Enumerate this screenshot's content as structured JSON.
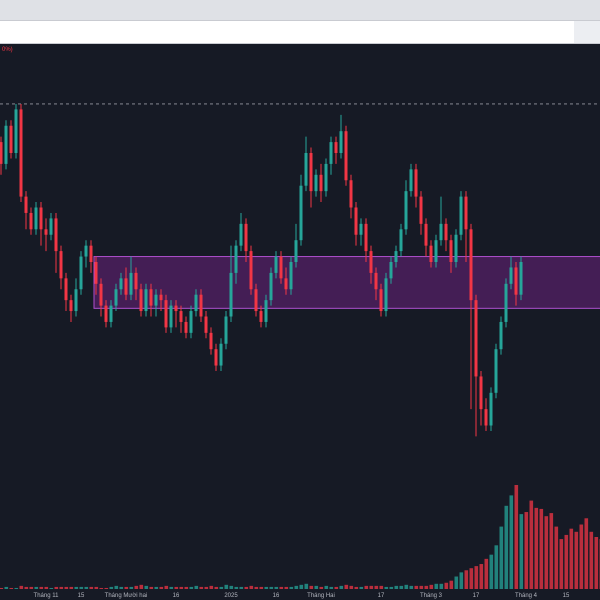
{
  "legend_fragment": "0%)",
  "colors": {
    "up": "#26a69a",
    "down": "#f23645",
    "background": "#161a25",
    "zone_fill": "rgba(156, 39, 176, 0.35)",
    "zone_border": "#b04fcf"
  },
  "chart_data": {
    "type": "candlestick",
    "title": "",
    "x_tick_labels": [
      "Tháng 11",
      "15",
      "Tháng Mười hai",
      "16",
      "2025",
      "16",
      "Tháng Hai",
      "17",
      "Tháng 3",
      "17",
      "Tháng 4",
      "15"
    ],
    "y_range": [
      0,
      100
    ],
    "reference_line_level": 89.0,
    "zone": {
      "low": 51.5,
      "high": 61.0
    },
    "grid": false,
    "candles": [
      {
        "o": 73,
        "c": 75,
        "h": 76,
        "l": 72
      },
      {
        "o": 75,
        "c": 82,
        "h": 84,
        "l": 74
      },
      {
        "o": 82,
        "c": 78,
        "h": 83,
        "l": 76
      },
      {
        "o": 78,
        "c": 85,
        "h": 86,
        "l": 77
      },
      {
        "o": 85,
        "c": 80,
        "h": 86,
        "l": 79
      },
      {
        "o": 80,
        "c": 88,
        "h": 89,
        "l": 79
      },
      {
        "o": 88,
        "c": 72,
        "h": 89,
        "l": 71
      },
      {
        "o": 72,
        "c": 69,
        "h": 73,
        "l": 66
      },
      {
        "o": 69,
        "c": 66,
        "h": 70,
        "l": 65
      },
      {
        "o": 66,
        "c": 70,
        "h": 71,
        "l": 65
      },
      {
        "o": 70,
        "c": 66,
        "h": 71,
        "l": 63
      },
      {
        "o": 66,
        "c": 65,
        "h": 68,
        "l": 62
      },
      {
        "o": 65,
        "c": 68,
        "h": 69,
        "l": 64
      },
      {
        "o": 68,
        "c": 62,
        "h": 69,
        "l": 58
      },
      {
        "o": 62,
        "c": 57,
        "h": 63,
        "l": 55
      },
      {
        "o": 57,
        "c": 53,
        "h": 58,
        "l": 51
      },
      {
        "o": 53,
        "c": 51,
        "h": 54,
        "l": 49
      },
      {
        "o": 51,
        "c": 55,
        "h": 57,
        "l": 50
      },
      {
        "o": 55,
        "c": 61,
        "h": 62,
        "l": 54
      },
      {
        "o": 61,
        "c": 63,
        "h": 64,
        "l": 59
      },
      {
        "o": 63,
        "c": 60,
        "h": 64,
        "l": 58
      },
      {
        "o": 60,
        "c": 56,
        "h": 61,
        "l": 54
      },
      {
        "o": 56,
        "c": 52,
        "h": 57,
        "l": 50
      },
      {
        "o": 52,
        "c": 49,
        "h": 53,
        "l": 48
      },
      {
        "o": 49,
        "c": 52,
        "h": 53,
        "l": 48
      },
      {
        "o": 52,
        "c": 55,
        "h": 56,
        "l": 51
      },
      {
        "o": 55,
        "c": 57,
        "h": 58,
        "l": 54
      },
      {
        "o": 57,
        "c": 54,
        "h": 59,
        "l": 53
      },
      {
        "o": 54,
        "c": 58,
        "h": 61,
        "l": 53
      },
      {
        "o": 58,
        "c": 55,
        "h": 59,
        "l": 53
      },
      {
        "o": 55,
        "c": 51,
        "h": 56,
        "l": 50
      },
      {
        "o": 51,
        "c": 55,
        "h": 56,
        "l": 50
      },
      {
        "o": 55,
        "c": 52,
        "h": 56,
        "l": 50
      },
      {
        "o": 52,
        "c": 54,
        "h": 55,
        "l": 50
      },
      {
        "o": 54,
        "c": 53,
        "h": 55,
        "l": 51
      },
      {
        "o": 53,
        "c": 48,
        "h": 54,
        "l": 47
      },
      {
        "o": 48,
        "c": 52,
        "h": 53,
        "l": 47
      },
      {
        "o": 52,
        "c": 51,
        "h": 53,
        "l": 48
      },
      {
        "o": 51,
        "c": 49,
        "h": 52,
        "l": 47
      },
      {
        "o": 49,
        "c": 47,
        "h": 50,
        "l": 46
      },
      {
        "o": 47,
        "c": 51,
        "h": 52,
        "l": 46
      },
      {
        "o": 51,
        "c": 54,
        "h": 55,
        "l": 50
      },
      {
        "o": 54,
        "c": 50,
        "h": 55,
        "l": 49
      },
      {
        "o": 50,
        "c": 47,
        "h": 51,
        "l": 46
      },
      {
        "o": 47,
        "c": 44,
        "h": 48,
        "l": 43
      },
      {
        "o": 44,
        "c": 41,
        "h": 45,
        "l": 40
      },
      {
        "o": 41,
        "c": 45,
        "h": 46,
        "l": 40
      },
      {
        "o": 45,
        "c": 50,
        "h": 51,
        "l": 44
      },
      {
        "o": 50,
        "c": 58,
        "h": 63,
        "l": 49
      },
      {
        "o": 58,
        "c": 63,
        "h": 64,
        "l": 56
      },
      {
        "o": 63,
        "c": 67,
        "h": 69,
        "l": 62
      },
      {
        "o": 67,
        "c": 62,
        "h": 68,
        "l": 60
      },
      {
        "o": 62,
        "c": 55,
        "h": 63,
        "l": 54
      },
      {
        "o": 55,
        "c": 51,
        "h": 56,
        "l": 50
      },
      {
        "o": 51,
        "c": 49,
        "h": 52,
        "l": 48
      },
      {
        "o": 49,
        "c": 53,
        "h": 54,
        "l": 48
      },
      {
        "o": 53,
        "c": 58,
        "h": 59,
        "l": 52
      },
      {
        "o": 58,
        "c": 61,
        "h": 62,
        "l": 57
      },
      {
        "o": 61,
        "c": 57,
        "h": 62,
        "l": 56
      },
      {
        "o": 57,
        "c": 55,
        "h": 59,
        "l": 54
      },
      {
        "o": 55,
        "c": 60,
        "h": 61,
        "l": 54
      },
      {
        "o": 60,
        "c": 64,
        "h": 67,
        "l": 59
      },
      {
        "o": 64,
        "c": 74,
        "h": 76,
        "l": 63
      },
      {
        "o": 74,
        "c": 80,
        "h": 83,
        "l": 73
      },
      {
        "o": 80,
        "c": 73,
        "h": 81,
        "l": 70
      },
      {
        "o": 73,
        "c": 76,
        "h": 77,
        "l": 72
      },
      {
        "o": 76,
        "c": 73,
        "h": 78,
        "l": 71
      },
      {
        "o": 73,
        "c": 78,
        "h": 79,
        "l": 72
      },
      {
        "o": 78,
        "c": 82,
        "h": 83,
        "l": 76
      },
      {
        "o": 82,
        "c": 80,
        "h": 83,
        "l": 78
      },
      {
        "o": 80,
        "c": 84,
        "h": 87,
        "l": 79
      },
      {
        "o": 84,
        "c": 75,
        "h": 85,
        "l": 74
      },
      {
        "o": 75,
        "c": 70,
        "h": 76,
        "l": 68
      },
      {
        "o": 70,
        "c": 65,
        "h": 71,
        "l": 63
      },
      {
        "o": 65,
        "c": 67,
        "h": 68,
        "l": 63
      },
      {
        "o": 67,
        "c": 62,
        "h": 68,
        "l": 60
      },
      {
        "o": 62,
        "c": 58,
        "h": 63,
        "l": 56
      },
      {
        "o": 58,
        "c": 55,
        "h": 59,
        "l": 53
      },
      {
        "o": 55,
        "c": 51,
        "h": 56,
        "l": 50
      },
      {
        "o": 51,
        "c": 57,
        "h": 58,
        "l": 50
      },
      {
        "o": 57,
        "c": 60,
        "h": 61,
        "l": 56
      },
      {
        "o": 60,
        "c": 62,
        "h": 63,
        "l": 59
      },
      {
        "o": 62,
        "c": 66,
        "h": 67,
        "l": 61
      },
      {
        "o": 66,
        "c": 73,
        "h": 75,
        "l": 65
      },
      {
        "o": 73,
        "c": 77,
        "h": 78,
        "l": 72
      },
      {
        "o": 77,
        "c": 72,
        "h": 78,
        "l": 70
      },
      {
        "o": 72,
        "c": 67,
        "h": 73,
        "l": 65
      },
      {
        "o": 67,
        "c": 63,
        "h": 68,
        "l": 61
      },
      {
        "o": 63,
        "c": 60,
        "h": 64,
        "l": 59
      },
      {
        "o": 60,
        "c": 64,
        "h": 65,
        "l": 59
      },
      {
        "o": 64,
        "c": 67,
        "h": 72,
        "l": 63
      },
      {
        "o": 67,
        "c": 64,
        "h": 68,
        "l": 62
      },
      {
        "o": 64,
        "c": 60,
        "h": 65,
        "l": 58
      },
      {
        "o": 60,
        "c": 65,
        "h": 66,
        "l": 59
      },
      {
        "o": 65,
        "c": 72,
        "h": 73,
        "l": 64
      },
      {
        "o": 72,
        "c": 66,
        "h": 73,
        "l": 60
      },
      {
        "o": 66,
        "c": 53,
        "h": 67,
        "l": 33
      },
      {
        "o": 53,
        "c": 39,
        "h": 54,
        "l": 28
      },
      {
        "o": 39,
        "c": 33,
        "h": 40,
        "l": 30
      },
      {
        "o": 33,
        "c": 30,
        "h": 35,
        "l": 29
      },
      {
        "o": 30,
        "c": 36,
        "h": 37,
        "l": 29
      },
      {
        "o": 36,
        "c": 44,
        "h": 45,
        "l": 35
      },
      {
        "o": 44,
        "c": 49,
        "h": 50,
        "l": 43
      },
      {
        "o": 49,
        "c": 56,
        "h": 57,
        "l": 48
      },
      {
        "o": 56,
        "c": 59,
        "h": 61,
        "l": 55
      },
      {
        "o": 59,
        "c": 54,
        "h": 60,
        "l": 52
      },
      {
        "o": 54,
        "c": 60,
        "h": 61,
        "l": 53
      }
    ],
    "volumes": [
      2,
      2,
      1,
      2,
      1,
      1,
      3,
      2,
      2,
      2,
      2,
      2,
      1,
      2,
      2,
      2,
      2,
      2,
      2,
      2,
      2,
      2,
      1,
      1,
      2,
      3,
      2,
      2,
      2,
      3,
      4,
      3,
      2,
      2,
      2,
      3,
      2,
      2,
      2,
      2,
      2,
      3,
      2,
      2,
      3,
      2,
      2,
      4,
      3,
      2,
      2,
      2,
      3,
      2,
      2,
      2,
      2,
      2,
      2,
      2,
      2,
      3,
      4,
      5,
      3,
      3,
      2,
      3,
      2,
      2,
      3,
      4,
      3,
      2,
      2,
      3,
      3,
      3,
      3,
      2,
      2,
      3,
      3,
      4,
      3,
      3,
      3,
      3,
      4,
      5,
      5,
      6,
      8,
      12,
      16,
      18,
      20,
      22,
      24,
      29,
      33,
      42,
      60,
      80,
      90,
      100,
      72,
      74,
      85,
      78,
      77,
      70,
      73,
      60,
      48,
      52,
      58,
      55,
      62,
      68,
      55,
      50,
      48,
      52,
      57
    ]
  }
}
